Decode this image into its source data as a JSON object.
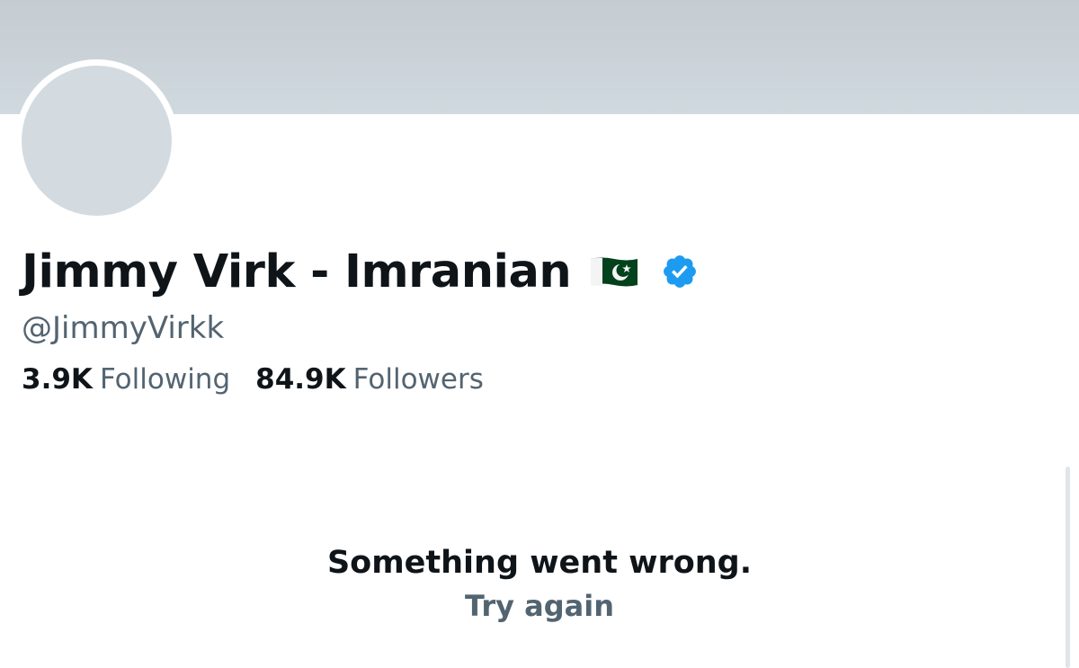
{
  "profile": {
    "display_name": "Jimmy Virk - Imranian",
    "handle": "@JimmyVirkk",
    "flag_icon": "pakistan-flag-icon",
    "verified_icon": "verified-badge-icon",
    "verified_color": "#1d9bf0"
  },
  "stats": {
    "following_count": "3.9K",
    "following_label": "Following",
    "followers_count": "84.9K",
    "followers_label": "Followers"
  },
  "error": {
    "message": "Something went wrong.",
    "retry_label": "Try again"
  }
}
